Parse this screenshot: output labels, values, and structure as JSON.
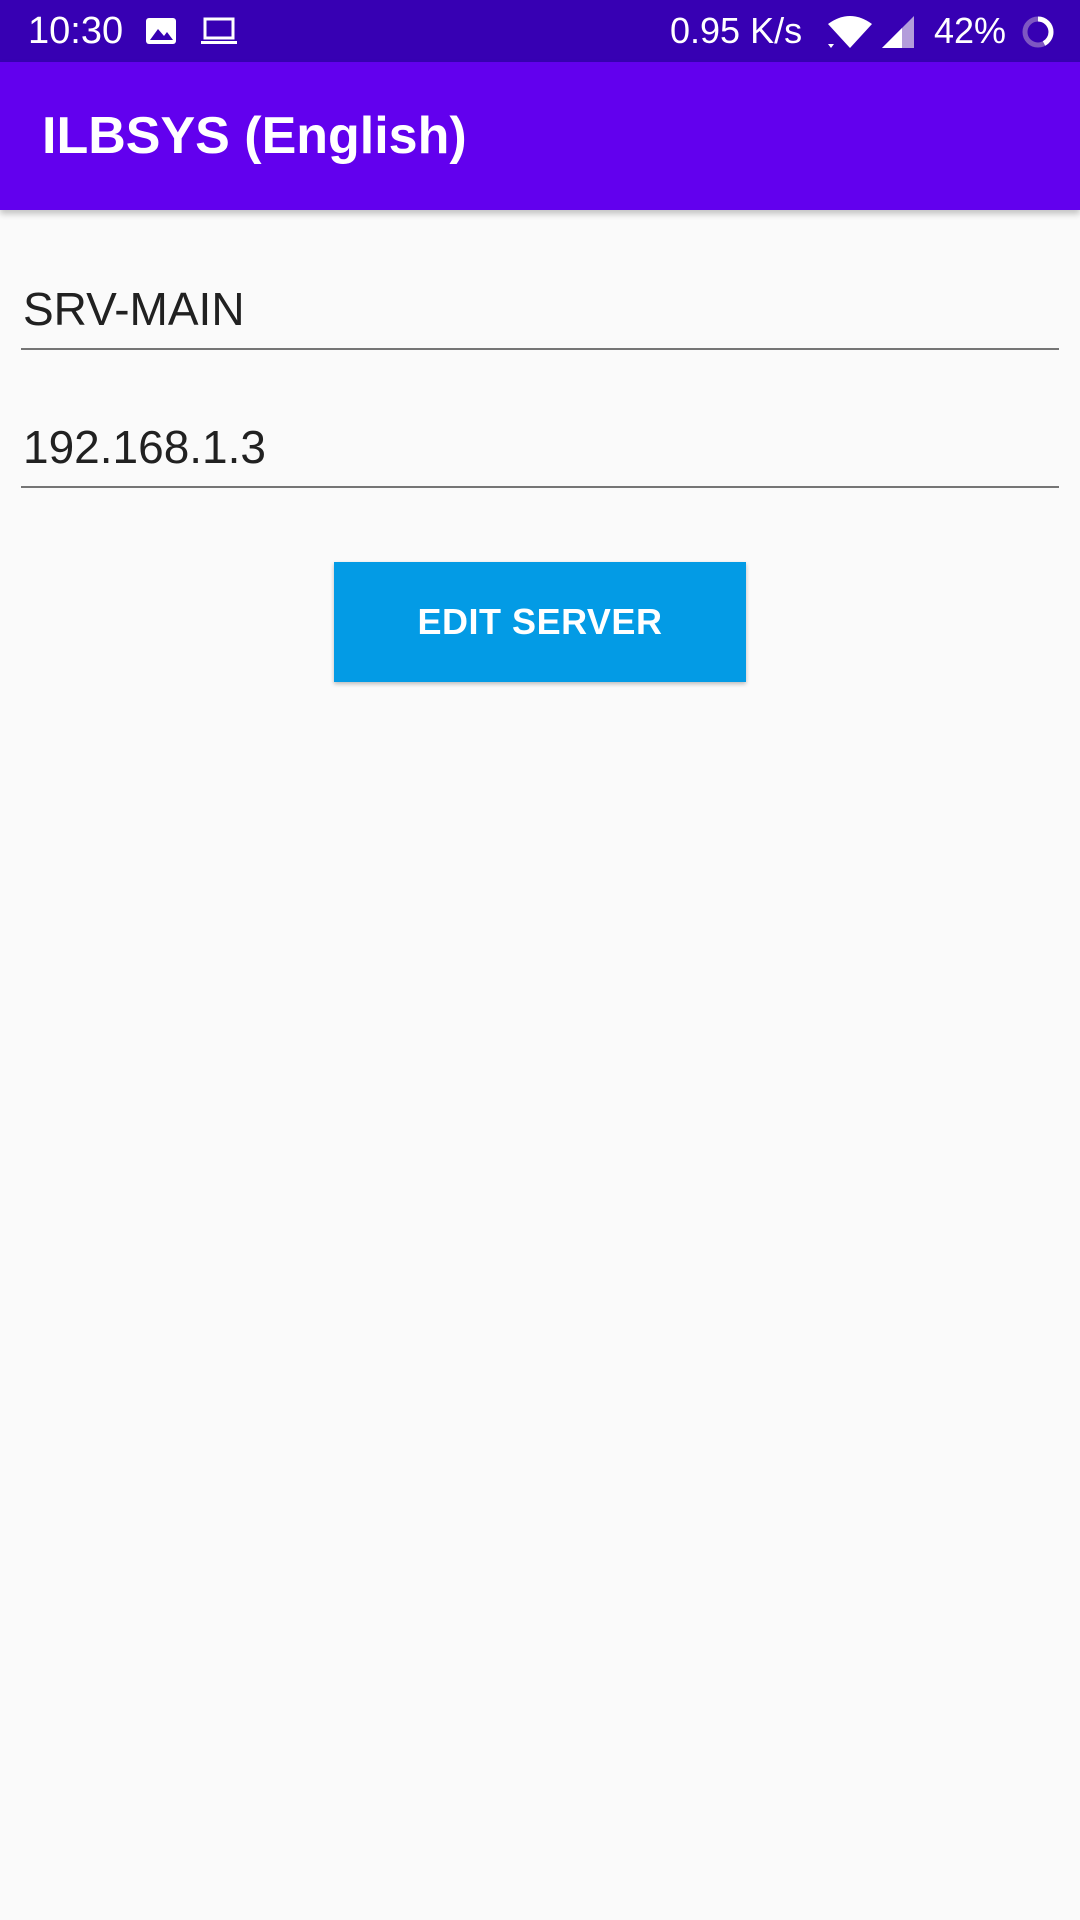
{
  "status_bar": {
    "time": "10:30",
    "icons": [
      "gallery-icon",
      "laptop-icon"
    ],
    "net_speed": "0.95 K/s",
    "battery": "42%",
    "battery_level": 0.42,
    "background_color": "#3700b3"
  },
  "app_bar": {
    "title": "ILBSYS (English)",
    "background_color": "#6200ee"
  },
  "form": {
    "server_name": "SRV-MAIN",
    "server_ip": "192.168.1.3",
    "edit_button_label": "EDIT SERVER",
    "button_color": "#039be5"
  }
}
